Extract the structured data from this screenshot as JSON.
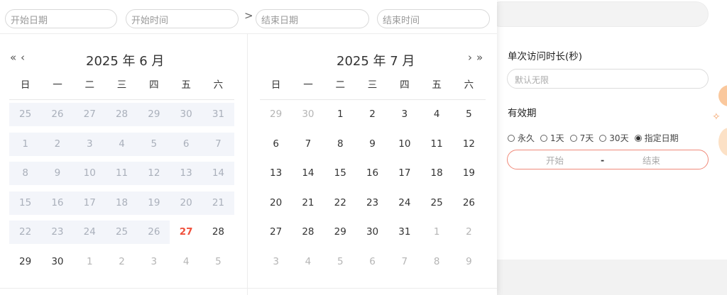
{
  "topbar": {
    "start_date_placeholder": "开始日期",
    "start_time_placeholder": "开始时间",
    "separator": ">",
    "end_date_placeholder": "结束日期",
    "end_time_placeholder": "结束时间"
  },
  "left_calendar": {
    "nav_prev_year": "«",
    "nav_prev_month": "‹",
    "title": "2025 年 6 月",
    "weekdays": [
      "日",
      "一",
      "二",
      "三",
      "四",
      "五",
      "六"
    ],
    "weeks": [
      [
        "25",
        "26",
        "27",
        "28",
        "29",
        "30",
        "31"
      ],
      [
        "1",
        "2",
        "3",
        "4",
        "5",
        "6",
        "7"
      ],
      [
        "8",
        "9",
        "10",
        "11",
        "12",
        "13",
        "14"
      ],
      [
        "15",
        "16",
        "17",
        "18",
        "19",
        "20",
        "21"
      ],
      [
        "22",
        "23",
        "24",
        "25",
        "26",
        "27",
        "28"
      ],
      [
        "29",
        "30",
        "1",
        "2",
        "3",
        "4",
        "5"
      ]
    ]
  },
  "right_calendar": {
    "nav_next_month": "›",
    "nav_next_year": "»",
    "title": "2025 年 7 月",
    "weekdays": [
      "日",
      "一",
      "二",
      "三",
      "四",
      "五",
      "六"
    ],
    "weeks": [
      [
        "29",
        "30",
        "1",
        "2",
        "3",
        "4",
        "5"
      ],
      [
        "6",
        "7",
        "8",
        "9",
        "10",
        "11",
        "12"
      ],
      [
        "13",
        "14",
        "15",
        "16",
        "17",
        "18",
        "19"
      ],
      [
        "20",
        "21",
        "22",
        "23",
        "24",
        "25",
        "26"
      ],
      [
        "27",
        "28",
        "29",
        "30",
        "31",
        "1",
        "2"
      ],
      [
        "3",
        "4",
        "5",
        "6",
        "7",
        "8",
        "9"
      ]
    ]
  },
  "form": {
    "duration_label": "单次访问时长(秒)",
    "duration_placeholder": "默认无限",
    "validity_label": "有效期",
    "options": [
      "永久",
      "1天",
      "7天",
      "30天",
      "指定日期"
    ],
    "selected_option": "指定日期",
    "range_start_placeholder": "开始",
    "range_separator": "-",
    "range_end_placeholder": "结束"
  },
  "colors": {
    "accent": "#f0503c",
    "disabled_bg": "#f3f5fa",
    "range_border": "#f08a7a"
  }
}
